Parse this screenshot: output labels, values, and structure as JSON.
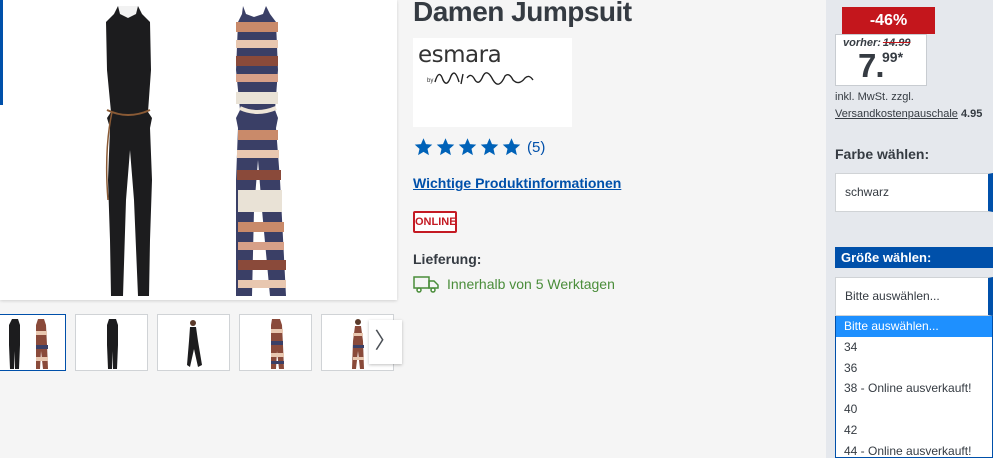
{
  "product": {
    "title": "Damen Jumpsuit",
    "brand": "esmara",
    "brand_signature": "by Heidi Klum",
    "rating_count": "(5)",
    "info_link": "Wichtige Produktinformationen",
    "badge": "ONLINE",
    "delivery_label": "Lieferung:",
    "delivery_text": "Innerhalb von 5 Werktagen"
  },
  "gallery": {
    "thumbnails": [
      "thumb-1",
      "thumb-2",
      "thumb-3",
      "thumb-4",
      "thumb-5"
    ],
    "next_icon": "〉"
  },
  "pricing": {
    "discount": "-46%",
    "before_label": "vorher:",
    "before_price": "14.99",
    "price_main": "7.",
    "price_cents": "99*",
    "tax_note": "inkl. MwSt. zzgl.",
    "shipping_link": "Versandkostenpauschale",
    "shipping_amount": "4.95"
  },
  "color": {
    "label": "Farbe wählen:",
    "value": "schwarz"
  },
  "size": {
    "label": "Größe wählen:",
    "value": "Bitte auswählen...",
    "options": [
      "Bitte auswählen...",
      "34",
      "36",
      "38 - Online ausverkauft!",
      "40",
      "42",
      "44 - Online ausverkauft!"
    ]
  },
  "colors": {
    "accent": "#0050aa",
    "sale": "#c4161c",
    "delivery": "#4a8d3a",
    "option_highlight": "#1e90ff"
  }
}
